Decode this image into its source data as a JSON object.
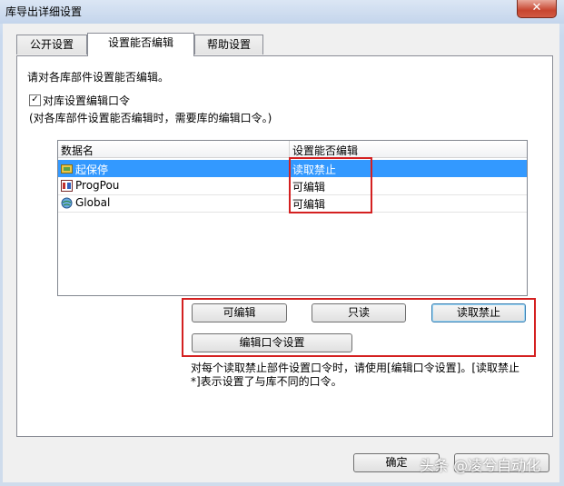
{
  "window": {
    "title": "库导出详细设置",
    "close_glyph": "✕"
  },
  "tabs": [
    {
      "label": "公开设置"
    },
    {
      "label": "设置能否编辑"
    },
    {
      "label": "帮助设置"
    }
  ],
  "panel": {
    "instruction": "请对各库部件设置能否编辑。",
    "checkbox_label": "对库设置编辑口令",
    "checkbox_checked": true,
    "checkbox_note": "(对各库部件设置能否编辑时，需要库的编辑口令。)",
    "table": {
      "columns": [
        "数据名",
        "设置能否编辑"
      ],
      "rows": [
        {
          "name": "起保停",
          "value": "读取禁止",
          "icon": "library-folder-icon"
        },
        {
          "name": "ProgPou",
          "value": "可编辑",
          "icon": "program-pou-icon"
        },
        {
          "name": "Global",
          "value": "可编辑",
          "icon": "global-variable-icon"
        }
      ]
    },
    "buttons": {
      "editable": "可编辑",
      "readonly": "只读",
      "read_prohibited": "读取禁止",
      "edit_password": "编辑口令设置"
    },
    "note": "对每个读取禁止部件设置口令时，请使用[编辑口令设置]。[读取禁止*]表示设置了与库不同的口令。"
  },
  "footer": {
    "ok_label": "确定",
    "watermark": "头条 @凌兮自动化"
  },
  "colors": {
    "selection": "#3399ff",
    "highlight_box": "#d42020"
  }
}
